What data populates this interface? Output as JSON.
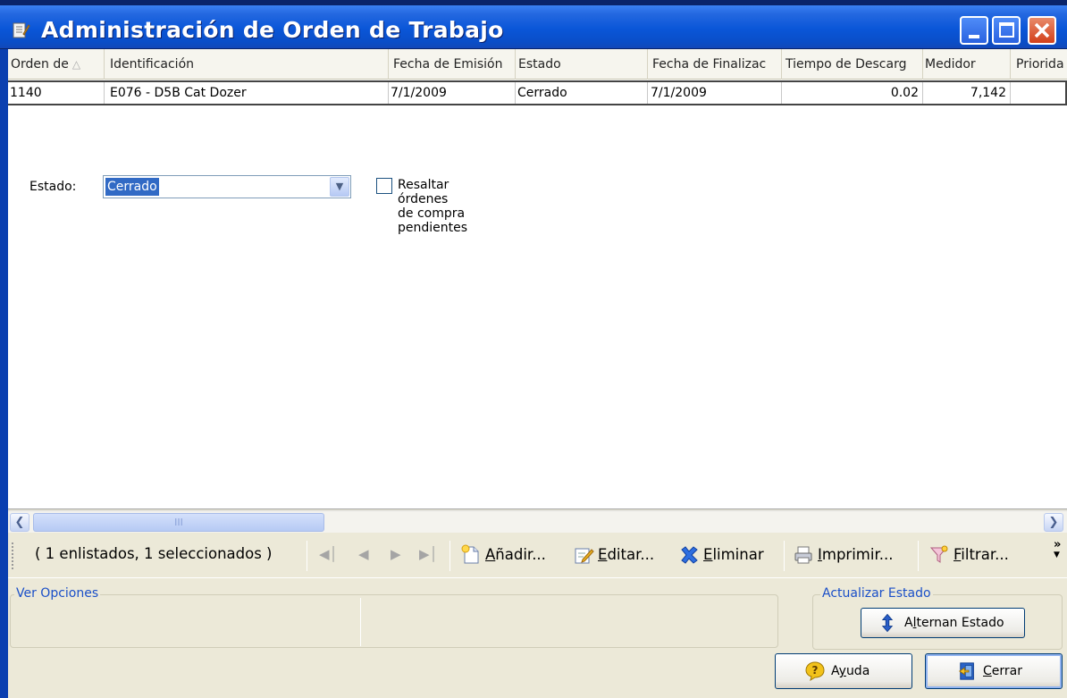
{
  "window": {
    "title": "Administración de Orden de Trabajo"
  },
  "grid": {
    "columns": [
      {
        "label": "Orden de",
        "sorted": true
      },
      {
        "label": "Identificación"
      },
      {
        "label": "Fecha de Emisión"
      },
      {
        "label": "Estado"
      },
      {
        "label": "Fecha de Finalizac"
      },
      {
        "label": "Tiempo de Descarg"
      },
      {
        "label": "Medidor"
      },
      {
        "label": "Priorida"
      }
    ],
    "rows": [
      {
        "orden": "1140",
        "identificacion": "E076 - D5B Cat Dozer",
        "fecha_emision": "7/1/2009",
        "estado": "Cerrado",
        "fecha_finalizacion": "7/1/2009",
        "tiempo_descarga": "0.02",
        "medidor": "7,142",
        "prioridad": ""
      }
    ],
    "scroll_thumb_grip": "III"
  },
  "toolbar": {
    "status": "( 1 enlistados, 1 seleccionados )",
    "add": {
      "pre": "",
      "key": "A",
      "post": "ñadir..."
    },
    "edit": {
      "pre": "",
      "key": "E",
      "post": "ditar..."
    },
    "delete": {
      "pre": "",
      "key": "E",
      "post": "liminar"
    },
    "print": {
      "pre": "",
      "key": "I",
      "post": "mprimir..."
    },
    "filter": {
      "pre": "",
      "key": "F",
      "post": "iltrar..."
    },
    "overflow": "»"
  },
  "options": {
    "group_title": "Ver Opciones",
    "estado_label": "Estado:",
    "estado_value": "Cerrado",
    "highlight_label": "Resaltar órdenes de compra pendientes",
    "highlight_checked": false
  },
  "update": {
    "group_title": "Actualizar Estado",
    "toggle": {
      "pre": "A",
      "key": "l",
      "post": "ternan Estado"
    }
  },
  "footer": {
    "help": {
      "pre": "A",
      "key": "y",
      "post": "uda"
    },
    "close": {
      "pre": "",
      "key": "C",
      "post": "errar"
    }
  },
  "colors": {
    "title_bar": "#0a56d8",
    "selection": "#316ac5",
    "group_title": "#1a4fc8"
  }
}
